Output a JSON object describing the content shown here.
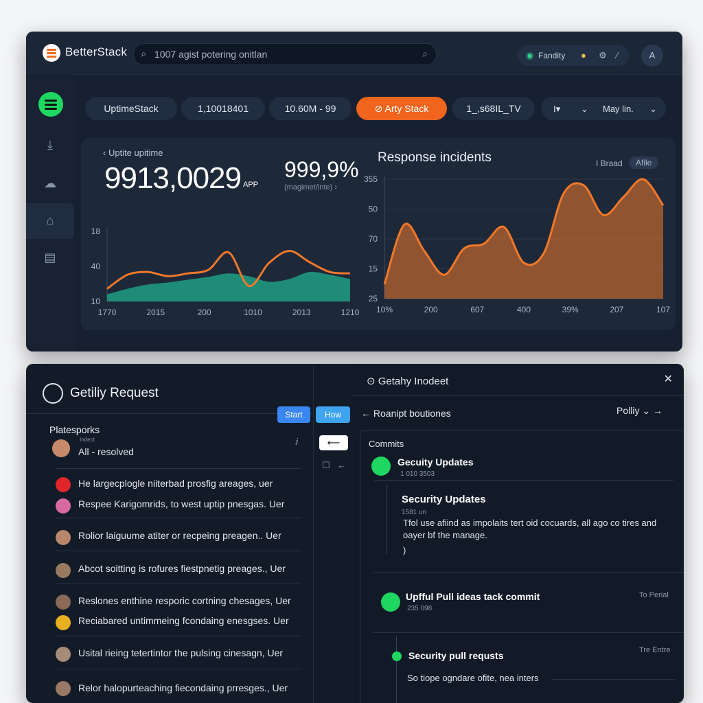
{
  "header": {
    "brand": "BetterStack",
    "search_text": "1007 agist potering onitlan",
    "pill_label": "Fandity",
    "avatar_letter": "A"
  },
  "stats": {
    "pills": [
      "UptimeStack",
      "1,10018401",
      "10.60M - 99",
      "Arty Stack",
      "1_,s68IL_TV"
    ],
    "dropdown_label": "May lin."
  },
  "uptime": {
    "label": "Uptite upitime",
    "big_value": "9913,0029",
    "big_suffix": "APP",
    "percent": "999,9%",
    "percent_sub": "(magimet/inte)"
  },
  "response": {
    "title": "Response incidents",
    "legend_a": "I Braad",
    "legend_b": "Afile"
  },
  "chart_data": [
    {
      "type": "area",
      "title": "",
      "ytick_labels": [
        "18",
        "40",
        "10"
      ],
      "xtick_labels": [
        "1770",
        "2015",
        "200",
        "1010",
        "2013",
        "1210"
      ],
      "series": [
        {
          "values": [
            10,
            18,
            24,
            27,
            31,
            35,
            40,
            36,
            28,
            32,
            42,
            38,
            32
          ]
        },
        {
          "values": [
            18,
            38,
            42,
            36,
            40,
            45,
            70,
            22,
            55,
            72,
            56,
            42,
            40
          ]
        }
      ],
      "colors": [
        "#1fae8c",
        "#f0782a"
      ]
    },
    {
      "type": "area",
      "title": "Response incidents",
      "ytick_labels": [
        "355",
        "50",
        "70",
        "15",
        "25"
      ],
      "xtick_labels": [
        "10%",
        "200",
        "607",
        "400",
        "39%",
        "207",
        "107"
      ],
      "series": [
        {
          "values": [
            12,
            62,
            40,
            20,
            42,
            46,
            60,
            30,
            38,
            88,
            95,
            70,
            85,
            100,
            78
          ]
        }
      ],
      "colors": [
        "#f0782a"
      ]
    }
  ],
  "requests": {
    "title": "Getiliy Request",
    "btn_start": "Start",
    "btn_how": "How",
    "platform": "Platesporks",
    "small_label": "Indect",
    "status": "All - resolved",
    "rows": [
      "He largecplogle niiterbad prosfig areages, uer",
      "Respee Karigomrids, to west uptip pnesgas. Uer",
      "Rolior laiguume atiter or recpeing preagen.. Uer",
      "Abcot soitting is rofures fiestpnetig preages., Uer",
      "Reslones enthine resporic cortning chesages, Uer",
      "Reciabared untimmeing fcondaing enesgses. Uer",
      "Usital rieing tetertintor the pulsing cinesagn, Uer",
      "Relor halopurteaching fiecondaing prresges., Uer"
    ]
  },
  "incident": {
    "title": "Getahy Inodeet",
    "sub": "Roanipt boutiones",
    "policy": "Polliy",
    "commits_label": "Commits",
    "c1_title": "Gecuity Updates",
    "c1_meta": "1 010 3503",
    "c2_title": "Security Updates",
    "c2_meta": "1581 un",
    "c2_body": "Tfol use afiind as impolaits tert oid cocuards, all ago co tires and oayer bf the manage.",
    "c2_close": ")",
    "c3_title": "Upfful Pull ideas tack commit",
    "c3_meta": "235 098",
    "c3_right": "To Perial",
    "c4_title": "Security pull requsts",
    "c4_right": "Tre Entre",
    "c4_body": "So tiope ogndare ofite, nea inters"
  }
}
